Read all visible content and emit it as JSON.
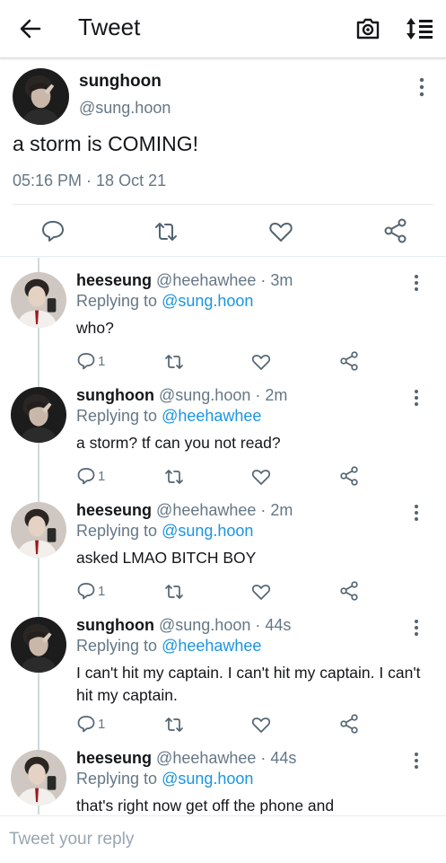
{
  "header": {
    "title": "Tweet"
  },
  "tweet": {
    "name": "sunghoon",
    "handle": "@sung.hoon",
    "text": "a storm is COMING!",
    "timestamp": "05:16 PM · 18 Oct 21"
  },
  "replies": [
    {
      "name": "heeseung",
      "handle_time": "@heehawhee · 3m",
      "replying_prefix": "Replying to ",
      "replying_to": "@sung.hoon",
      "text": "who?",
      "reply_count": "1"
    },
    {
      "name": "sunghoon",
      "handle_time": "@sung.hoon · 2m",
      "replying_prefix": "Replying to ",
      "replying_to": "@heehawhee",
      "text": "a storm? tf can you not read?",
      "reply_count": "1"
    },
    {
      "name": "heeseung",
      "handle_time": "@heehawhee · 2m",
      "replying_prefix": "Replying to ",
      "replying_to": "@sung.hoon",
      "text": "asked LMAO BITCH BOY",
      "reply_count": "1"
    },
    {
      "name": "sunghoon",
      "handle_time": "@sung.hoon · 44s",
      "replying_prefix": "Replying to ",
      "replying_to": "@heehawhee",
      "text": "I can't hit my captain. I can't hit my captain. I can't hit my captain.",
      "reply_count": "1"
    },
    {
      "name": "heeseung",
      "handle_time": "@heehawhee · 44s",
      "replying_prefix": "Replying to ",
      "replying_to": "@sung.hoon",
      "text": "that's right now get off the phone and"
    }
  ],
  "composer": {
    "placeholder": "Tweet your reply"
  },
  "icons": {
    "back": "arrow-left-icon",
    "camera": "camera-icon",
    "sort": "sort-icon",
    "more": "more-vertical-icon",
    "reply": "reply-icon",
    "retweet": "retweet-icon",
    "like": "heart-icon",
    "share": "share-icon"
  },
  "colors": {
    "link": "#1b95e0",
    "muted": "#657786",
    "icon": "#536471"
  }
}
